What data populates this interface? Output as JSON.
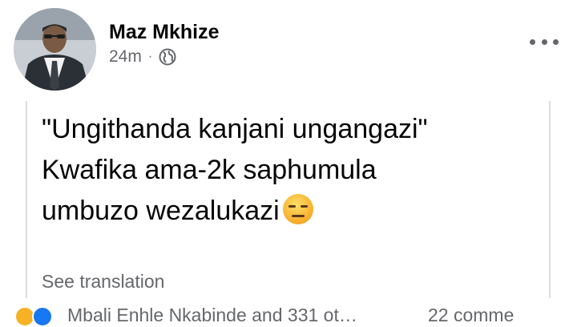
{
  "post": {
    "author": "Maz Mkhize",
    "time": "24m",
    "separator": "·",
    "privacy_icon": "globe-icon",
    "more_icon": "more-horizontal-icon",
    "text_lines": [
      "\"Ungithanda kanjani ungangazi\"",
      "Kwafika ama-2k saphumula",
      "umbuzo wezalukazi"
    ],
    "emoji": "expressionless-face-emoji",
    "see_translation": "See translation"
  },
  "footer": {
    "reaction_icons": [
      "haha-icon",
      "like-icon"
    ],
    "reactors": "Mbali Enhle Nkabinde and 331 ot…",
    "comments": "22 comme"
  },
  "colors": {
    "text": "#050505",
    "secondary_text": "#65676b",
    "border": "#dadde1",
    "like_blue": "#1877f2",
    "haha_yellow": "#f7b125"
  }
}
